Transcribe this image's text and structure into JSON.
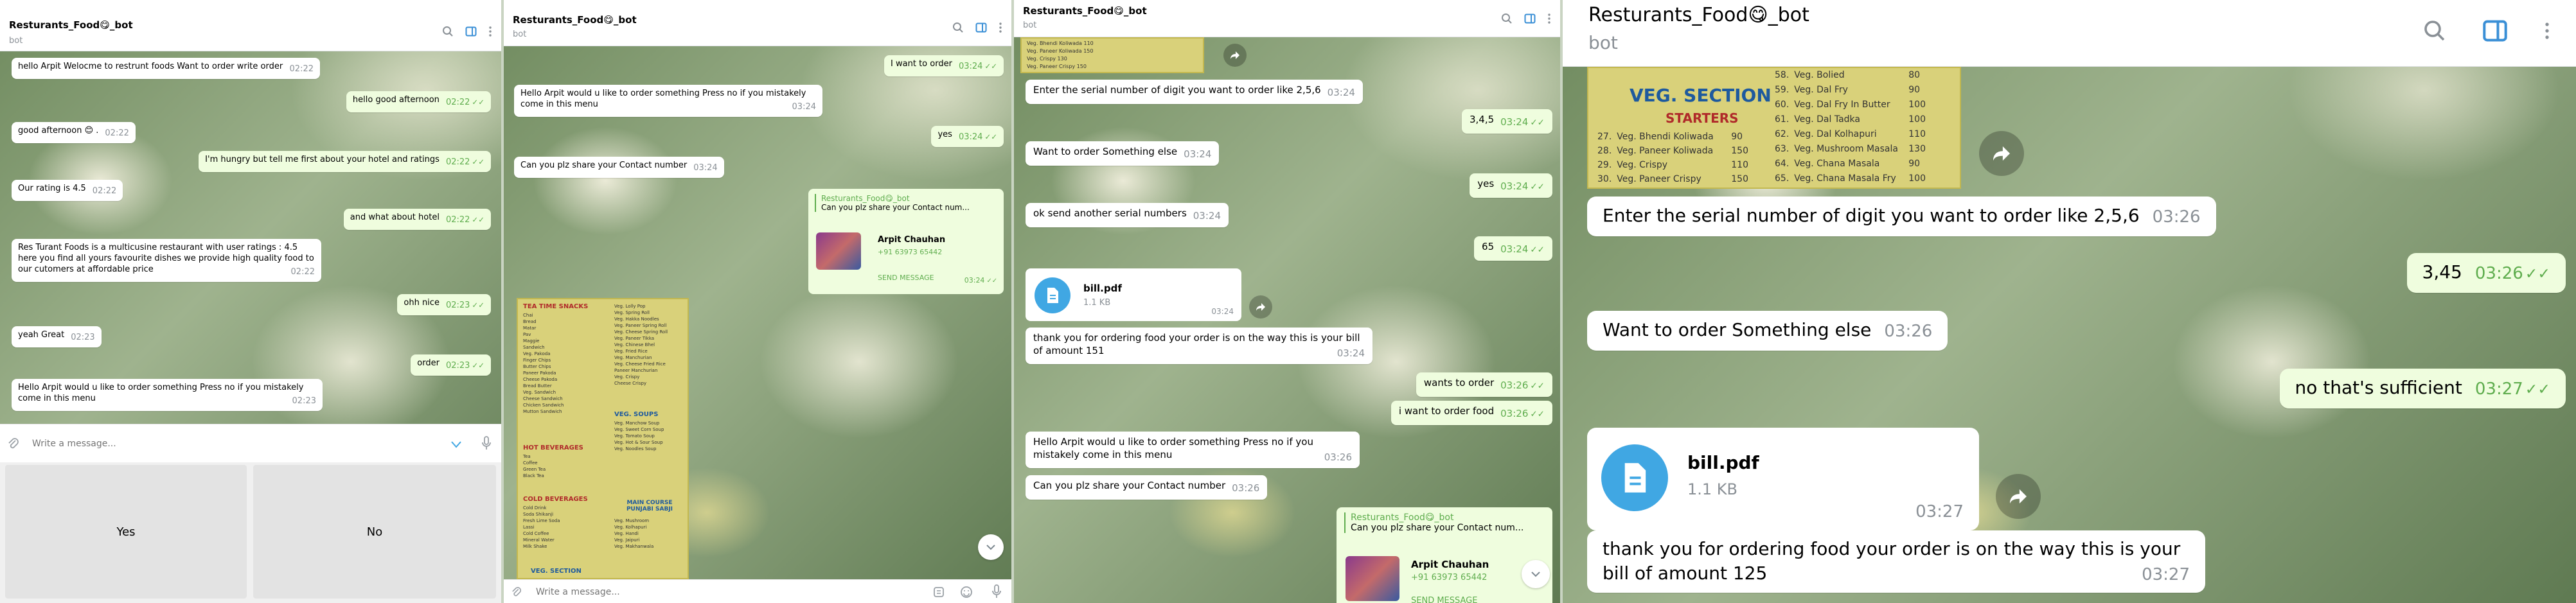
{
  "bot": {
    "title": "Resturants_Food😋_bot",
    "subtitle": "bot"
  },
  "colors": {
    "accent": "#40a7e3",
    "outgoing_bg": "#effdde",
    "check": "#5fad4e",
    "menu_bg": "#d9d17a",
    "menu_title": "#1e5a9e"
  },
  "icons": {
    "search": "search-icon",
    "sidebar": "sidebar-toggle-icon",
    "more": "more-vert-icon",
    "attach": "paperclip-icon",
    "emoji": "emoji-icon",
    "mic": "microphone-icon",
    "forward": "forward-arrow-icon",
    "file": "document-icon",
    "scroll": "chevron-down-icon",
    "keyboard": "keyboard-icon"
  },
  "panel1": {
    "messages": [
      {
        "text": "hello Arpit Welocme to restrunt foods Want to order write order",
        "time": "02:22",
        "dir": "in"
      },
      {
        "text": "hello good afternoon",
        "time": "02:22",
        "dir": "out"
      },
      {
        "text": "good afternoon 😊 .",
        "time": "02:22",
        "dir": "in"
      },
      {
        "text": "I'm hungry but tell me first about your hotel and ratings",
        "time": "02:22",
        "dir": "out"
      },
      {
        "text": "Our rating is 4.5",
        "time": "02:22",
        "dir": "in"
      },
      {
        "text": "and what about hotel",
        "time": "02:22",
        "dir": "out"
      },
      {
        "text": "Res Turant Foods is a multicusine restaurant with user ratings : 4.5 here you find all yours favourite dishes we provide high quality food to our cutomers at affordable price",
        "time": "02:22",
        "dir": "in"
      },
      {
        "text": "ohh nice",
        "time": "02:23",
        "dir": "out"
      },
      {
        "text": "yeah Great",
        "time": "02:23",
        "dir": "in"
      },
      {
        "text": "order",
        "time": "02:23",
        "dir": "out"
      },
      {
        "text": "Hello Arpit would u like to order something Press no if you mistakely come in this menu",
        "time": "02:23",
        "dir": "in"
      }
    ],
    "compose_placeholder": "Write a message...",
    "keyboard": {
      "yes": "Yes",
      "no": "No"
    }
  },
  "panel2": {
    "messages": [
      {
        "text": "I want to order",
        "time": "03:24",
        "dir": "out"
      },
      {
        "text": "Hello Arpit would u like to order something Press no if you mistakely come in this menu",
        "time": "03:24",
        "dir": "in"
      },
      {
        "text": "yes",
        "time": "03:24",
        "dir": "out"
      },
      {
        "text": "Can you plz share your Contact number",
        "time": "03:24",
        "dir": "in"
      }
    ],
    "reply": {
      "name": "Resturants_Food😋_bot",
      "text": "Can you plz share your Contact num..."
    },
    "contact": {
      "name": "Arpit Chauhan",
      "phone": "+91 63973 65442",
      "action": "SEND MESSAGE",
      "time": "03:24"
    },
    "menu": {
      "sections": [
        "TEA TIME SNACKS",
        "HOT BEVERAGES",
        "COLD BEVERAGES",
        "VEG. SOUPS",
        "MAIN COURSE PUNJABI SABJI",
        "VEG. SECTION"
      ],
      "items_left": [
        "Chai",
        "Bread",
        "Matar",
        "Pav",
        "Maggie",
        "Sandwich",
        "Veg. Pakoda",
        "Finger Chips",
        "Butter Chips",
        "Paneer Pakoda",
        "Cheese Pakoda",
        "Bread Butter",
        "Veg. Sandwich",
        "Cheese Sandwich",
        "Chicken Sandwich",
        "Mutton Sandwich"
      ],
      "items_right": [
        "Veg. Lolly Pop",
        "Veg. Spring Roll",
        "Veg. Hakka Noodles",
        "Veg. Paneer Spring Roll",
        "Veg. Cheese Spring Roll",
        "Veg. Paneer Tikka",
        "Veg. Chinese Bhel",
        "Veg. Fried Rice",
        "Veg. Manchurian",
        "Veg. Cheese Fried Rice",
        "Paneer Manchurian",
        "Veg. Crispy",
        "Cheese Crispy"
      ],
      "hot_bev": [
        "Tea",
        "Coffee",
        "Green Tea",
        "Black Tea"
      ],
      "cold_bev": [
        "Cold Drink",
        "Soda Shikanji",
        "Fresh Lime Soda",
        "Lassi",
        "Cold Coffee",
        "Mineral Water",
        "Milk Shake"
      ],
      "soups": [
        "Veg. Manchow Soup",
        "Veg. Sweet Corn Soup",
        "Veg. Tomato Soup",
        "Veg. Hot & Sour Soup",
        "Veg. Noodles Soup"
      ],
      "sabji": [
        "Veg. Mushroom",
        "Veg. Kolhapuri",
        "Veg. Handi",
        "Veg. Jaipuri",
        "Veg. Makhanwala"
      ]
    },
    "compose_placeholder": "Write a message..."
  },
  "panel3": {
    "menu_lines": [
      "Veg. Bhendi Koliwada  110",
      "Veg. Paneer Koliwada  150",
      "Veg. Crispy  130",
      "Veg. Paneer Crispy  150"
    ],
    "messages": [
      {
        "text": "Enter the serial number of digit you want to order like 2,5,6",
        "time": "03:24",
        "dir": "in"
      },
      {
        "text": "3,4,5",
        "time": "03:24",
        "dir": "out"
      },
      {
        "text": "Want to order Something else",
        "time": "03:24",
        "dir": "in"
      },
      {
        "text": "yes",
        "time": "03:24",
        "dir": "out"
      },
      {
        "text": "ok send another serial numbers",
        "time": "03:24",
        "dir": "in"
      },
      {
        "text": "65",
        "time": "03:24",
        "dir": "out"
      },
      {
        "text": "thank you for ordering food your order is on the way this is your bill of amount 151",
        "time": "03:24",
        "dir": "in"
      },
      {
        "text": "wants to order",
        "time": "03:26",
        "dir": "out"
      },
      {
        "text": "i want to order food",
        "time": "03:26",
        "dir": "out"
      },
      {
        "text": "Hello Arpit would u like to order something Press no if you mistakely come in this menu",
        "time": "03:26",
        "dir": "in"
      },
      {
        "text": "Can you plz share your Contact number",
        "time": "03:26",
        "dir": "in"
      }
    ],
    "file": {
      "name": "bill.pdf",
      "size": "1.1 KB",
      "time": "03:24"
    },
    "reply": {
      "name": "Resturants_Food😋_bot",
      "text": "Can you plz share your Contact num..."
    },
    "contact": {
      "name": "Arpit Chauhan",
      "phone": "+91 63973 65442",
      "action": "SEND MESSAGE"
    }
  },
  "panel4": {
    "menu": {
      "title": "VEG. SECTION",
      "subtitle": "STARTERS",
      "left": [
        {
          "no": "27.",
          "name": "Veg. Bhendi Koliwada",
          "price": "90"
        },
        {
          "no": "28.",
          "name": "Veg. Paneer Koliwada",
          "price": "150"
        },
        {
          "no": "29.",
          "name": "Veg. Crispy",
          "price": "110"
        },
        {
          "no": "30.",
          "name": "Veg. Paneer Crispy",
          "price": "150"
        }
      ],
      "right": [
        {
          "no": "58.",
          "name": "Veg. Bolied",
          "price": "80"
        },
        {
          "no": "59.",
          "name": "Veg. Dal Fry",
          "price": "90"
        },
        {
          "no": "60.",
          "name": "Veg. Dal Fry In Butter",
          "price": "100"
        },
        {
          "no": "61.",
          "name": "Veg. Dal Tadka",
          "price": "100"
        },
        {
          "no": "62.",
          "name": "Veg. Dal Kolhapuri",
          "price": "110"
        },
        {
          "no": "63.",
          "name": "Veg. Mushroom Masala",
          "price": "130"
        },
        {
          "no": "64.",
          "name": "Veg. Chana Masala",
          "price": "90"
        },
        {
          "no": "65.",
          "name": "Veg. Chana Masala Fry",
          "price": "100"
        }
      ]
    },
    "messages": [
      {
        "text": "Enter the serial number of digit you want to order like 2,5,6",
        "time": "03:26",
        "dir": "in"
      },
      {
        "text": "3,45",
        "time": "03:26",
        "dir": "out"
      },
      {
        "text": "Want to order Something else",
        "time": "03:26",
        "dir": "in"
      },
      {
        "text": "no that's sufficient",
        "time": "03:27",
        "dir": "out"
      },
      {
        "text": "thank you for ordering food your order is on the way this is your bill of amount 125",
        "time": "03:27",
        "dir": "in"
      }
    ],
    "file": {
      "name": "bill.pdf",
      "size": "1.1 KB",
      "time": "03:27"
    }
  }
}
